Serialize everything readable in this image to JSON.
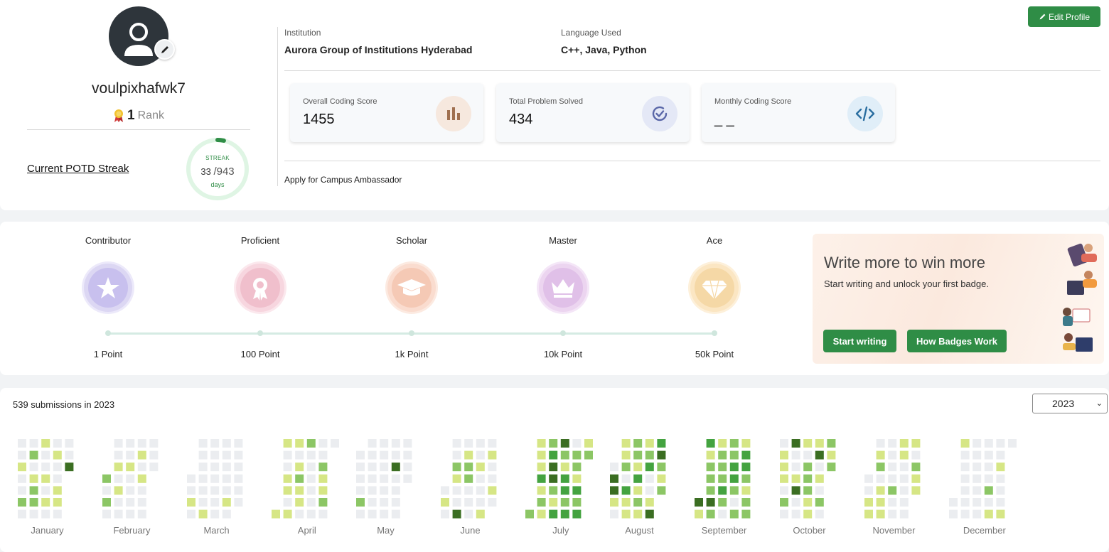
{
  "profile": {
    "username": "voulpixhafwk7",
    "rank_number": "1",
    "rank_label": "Rank",
    "potd_label": "Current POTD Streak",
    "streak_caption": "STREAK",
    "streak_current": "33",
    "streak_total": "/943",
    "streak_unit": "days",
    "streak_fraction": 0.035
  },
  "info": {
    "institution_label": "Institution",
    "institution_value": "Aurora Group of Institutions Hyderabad",
    "language_label": "Language Used",
    "language_value": "C++, Java, Python"
  },
  "scores": [
    {
      "label": "Overall Coding Score",
      "value": "1455",
      "icon": "bar-chart-icon",
      "icon_bg": "#f6e8de",
      "icon_color": "#a07050"
    },
    {
      "label": "Total Problem Solved",
      "value": "434",
      "icon": "check-circle-icon",
      "icon_bg": "#e4e8f6",
      "icon_color": "#5a67a8"
    },
    {
      "label": "Monthly Coding Score",
      "value": "_ _",
      "icon": "code-icon",
      "icon_bg": "#e0eef8",
      "icon_color": "#2a6ea0"
    }
  ],
  "ambassador_link": "Apply for Campus Ambassador",
  "edit_profile_label": "Edit Profile",
  "badges": [
    {
      "name": "Contributor",
      "point": "1 Point",
      "icon": "star-icon",
      "bg": "#dcd7f3",
      "ring": "#c8c0ee"
    },
    {
      "name": "Proficient",
      "point": "100 Point",
      "icon": "award-icon",
      "bg": "#f7d6df",
      "ring": "#f0bfcc"
    },
    {
      "name": "Scholar",
      "point": "1k Point",
      "icon": "graduation-cap-icon",
      "bg": "#fadccf",
      "ring": "#f5c9b5"
    },
    {
      "name": "Master",
      "point": "10k Point",
      "icon": "crown-icon",
      "bg": "#ecd5f0",
      "ring": "#e0c0e8"
    },
    {
      "name": "Ace",
      "point": "50k Point",
      "icon": "diamond-icon",
      "bg": "#fbe6c3",
      "ring": "#f5d8a6"
    }
  ],
  "promo": {
    "title": "Write more to win more",
    "subtitle": "Start writing and unlock your first badge.",
    "start_label": "Start writing",
    "how_label": "How Badges Work"
  },
  "heatmap": {
    "summary": "539 submissions in 2023",
    "year": "2023",
    "months": [
      "January",
      "February",
      "March",
      "April",
      "May",
      "June",
      "July",
      "August",
      "September",
      "October",
      "November",
      "December"
    ],
    "colors": [
      "#ebedf0",
      "#d6e685",
      "#8cc665",
      "#44a340",
      "#3b6e22"
    ]
  }
}
